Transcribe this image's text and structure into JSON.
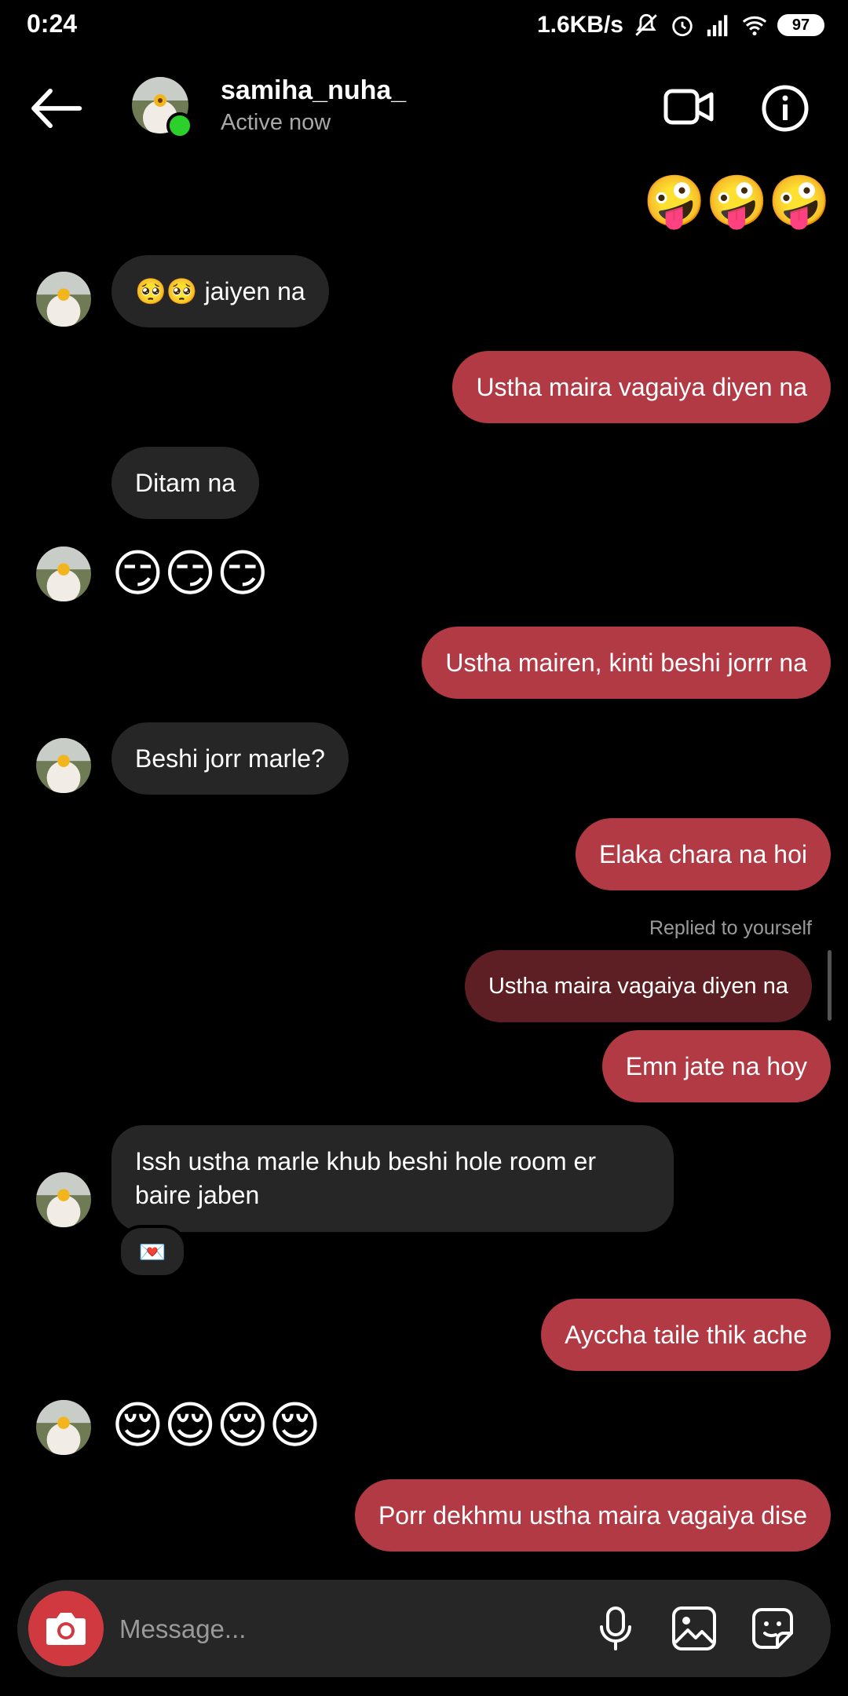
{
  "status_bar": {
    "time": "0:24",
    "network_speed": "1.6KB/s",
    "battery": "97",
    "icons": [
      "mute-icon",
      "alarm-icon",
      "signal-icon",
      "wifi-icon",
      "battery-icon"
    ]
  },
  "header": {
    "username": "samiha_nuha_",
    "status": "Active now",
    "icons": [
      "back-arrow-icon",
      "video-call-icon",
      "info-icon"
    ]
  },
  "messages": [
    {
      "from": "me",
      "emoji": "🤪🤪🤪"
    },
    {
      "from": "them",
      "text": "🥺🥺 jaiyen na"
    },
    {
      "from": "me",
      "text": "Ustha maira vagaiya diyen na"
    },
    {
      "from": "them",
      "text": "Ditam na"
    },
    {
      "from": "them",
      "emoji": "😏😏😏"
    },
    {
      "from": "me",
      "text": "Ustha mairen, kinti beshi jorrr na"
    },
    {
      "from": "them",
      "text": "Beshi jorr marle?"
    },
    {
      "from": "me",
      "text": "Elaka chara na hoi"
    },
    {
      "from": "me",
      "reply_label": "Replied to yourself",
      "reply_text": "Ustha maira vagaiya diyen na",
      "text": "Emn jate na hoy"
    },
    {
      "from": "them",
      "text": "Issh ustha marle khub beshi hole room er baire jaben",
      "reaction": "💌"
    },
    {
      "from": "me",
      "text": "Ayccha taile thik ache"
    },
    {
      "from": "them",
      "emoji": "😌😌😌😌"
    },
    {
      "from": "me",
      "text": "Porr dekhmu ustha maira vagaiya dise"
    }
  ],
  "composer": {
    "placeholder": "Message...",
    "icons": [
      "camera-icon",
      "microphone-icon",
      "gallery-icon",
      "sticker-icon"
    ]
  },
  "colors": {
    "background": "#000000",
    "incoming_bubble": "#262626",
    "outgoing_bubble": "#b23a45",
    "reply_bubble": "#5e1f24",
    "online": "#2bd02b",
    "camera_button": "#d0393f"
  }
}
